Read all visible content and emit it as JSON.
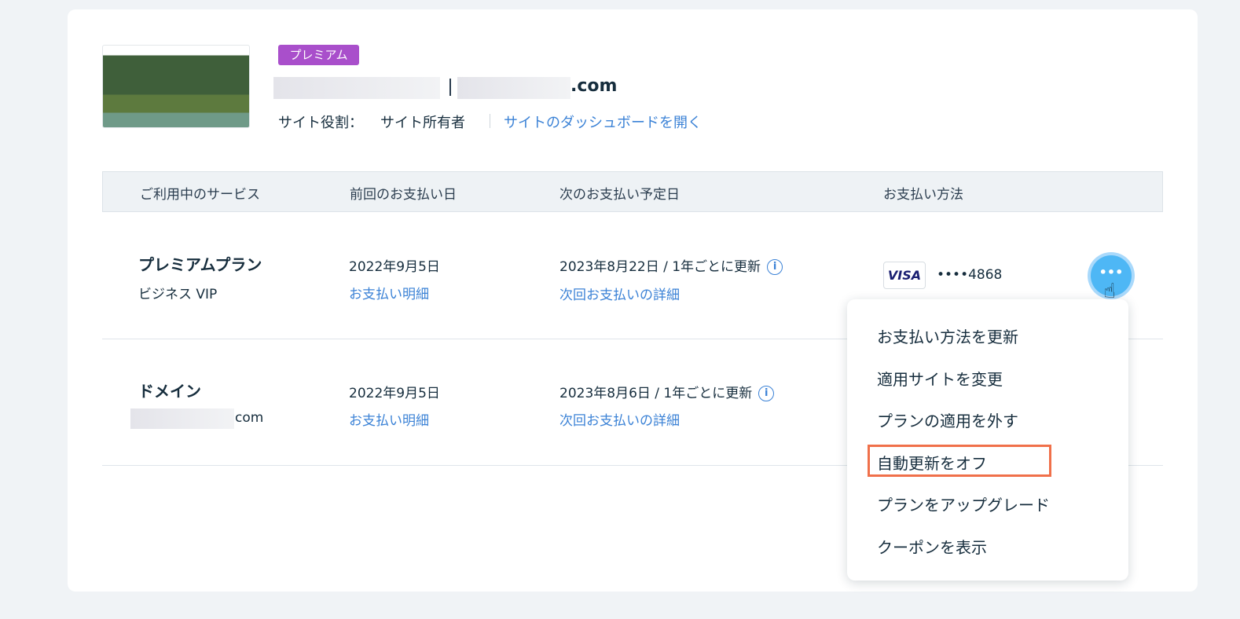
{
  "site": {
    "badge": "プレミアム",
    "domain_suffix": ".com",
    "role_label": "サイト役割：",
    "role_value": "サイト所有者",
    "dashboard_link": "サイトのダッシュボードを開く"
  },
  "table": {
    "headers": [
      "ご利用中のサービス",
      "前回のお支払い日",
      "次のお支払い予定日",
      "お支払い方法"
    ],
    "rows": [
      {
        "service": "プレミアムプラン",
        "subtitle": "ビジネス VIP",
        "last_date": "2022年9月5日",
        "last_link": "お支払い明細",
        "next_date": "2023年8月22日 / 1年ごとに更新",
        "next_link": "次回お支払いの詳細",
        "card_brand": "VISA",
        "card_number": "••••4868"
      },
      {
        "service": "ドメイン",
        "subtitle": "com",
        "last_date": "2022年9月5日",
        "last_link": "お支払い明細",
        "next_date": "2023年8月6日 / 1年ごとに更新",
        "next_link": "次回お支払いの詳細"
      }
    ]
  },
  "more_button": "•••",
  "menu": {
    "items": [
      "お支払い方法を更新",
      "適用サイトを変更",
      "プランの適用を外す",
      "自動更新をオフ",
      "プランをアップグレード",
      "クーポンを表示"
    ],
    "highlighted": "自動更新をオフ",
    "highlight_color": "#f0704a"
  },
  "colors": {
    "accent": "#3b82d6",
    "badge": "#a94fcb",
    "button": "#4eb7f5"
  }
}
